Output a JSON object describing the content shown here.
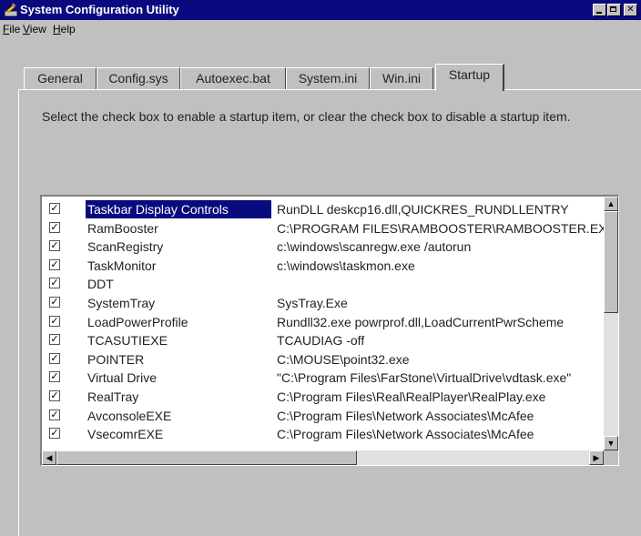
{
  "window": {
    "title": "System Configuration Utility"
  },
  "menu": [
    {
      "underline": "F",
      "rest": "ile"
    },
    {
      "underline": "V",
      "rest": "iew"
    },
    {
      "underline": "H",
      "rest": "elp"
    }
  ],
  "tabs": [
    "General",
    "Config.sys",
    "Autoexec.bat",
    "System.ini",
    "Win.ini",
    "Startup"
  ],
  "active_tab": "Startup",
  "instruction": "Select the check box to enable a startup item, or clear the check box to disable a startup item.",
  "startup_items": [
    {
      "name": "Taskbar Display Controls",
      "command": "RunDLL deskcp16.dll,QUICKRES_RUNDLLENTRY",
      "checked": true,
      "selected": true
    },
    {
      "name": "RamBooster",
      "command": "C:\\PROGRAM FILES\\RAMBOOSTER\\RAMBOOSTER.EXE",
      "checked": true
    },
    {
      "name": "ScanRegistry",
      "command": "c:\\windows\\scanregw.exe /autorun",
      "checked": true
    },
    {
      "name": "TaskMonitor",
      "command": "c:\\windows\\taskmon.exe",
      "checked": true
    },
    {
      "name": "DDT",
      "command": "",
      "checked": true
    },
    {
      "name": "SystemTray",
      "command": "SysTray.Exe",
      "checked": true
    },
    {
      "name": "LoadPowerProfile",
      "command": "Rundll32.exe powrprof.dll,LoadCurrentPwrScheme",
      "checked": true
    },
    {
      "name": "TCASUTIEXE",
      "command": "TCAUDIAG -off",
      "checked": true
    },
    {
      "name": "POINTER",
      "command": "C:\\MOUSE\\point32.exe",
      "checked": true
    },
    {
      "name": "Virtual Drive",
      "command": "\"C:\\Program Files\\FarStone\\VirtualDrive\\vdtask.exe\"",
      "checked": true
    },
    {
      "name": "RealTray",
      "command": "C:\\Program Files\\Real\\RealPlayer\\RealPlay.exe",
      "checked": true
    },
    {
      "name": "AvconsoleEXE",
      "command": "C:\\Program Files\\Network Associates\\McAfee",
      "checked": true
    },
    {
      "name": "VsecomrEXE",
      "command": "C:\\Program Files\\Network Associates\\McAfee",
      "checked": true
    }
  ],
  "icons": {
    "app": "system-config-icon",
    "minimize": "minimize-icon",
    "maximize": "maximize-icon",
    "close": "close-icon",
    "checkbox": "checkmark-icon",
    "scroll_up": "scroll-up-arrow-icon",
    "scroll_down": "scroll-down-arrow-icon",
    "scroll_left": "scroll-left-arrow-icon",
    "scroll_right": "scroll-right-arrow-icon"
  },
  "colors": {
    "title_bar": "#0a0a80",
    "selection": "#0a0a80",
    "face": "#c0c0c0"
  }
}
